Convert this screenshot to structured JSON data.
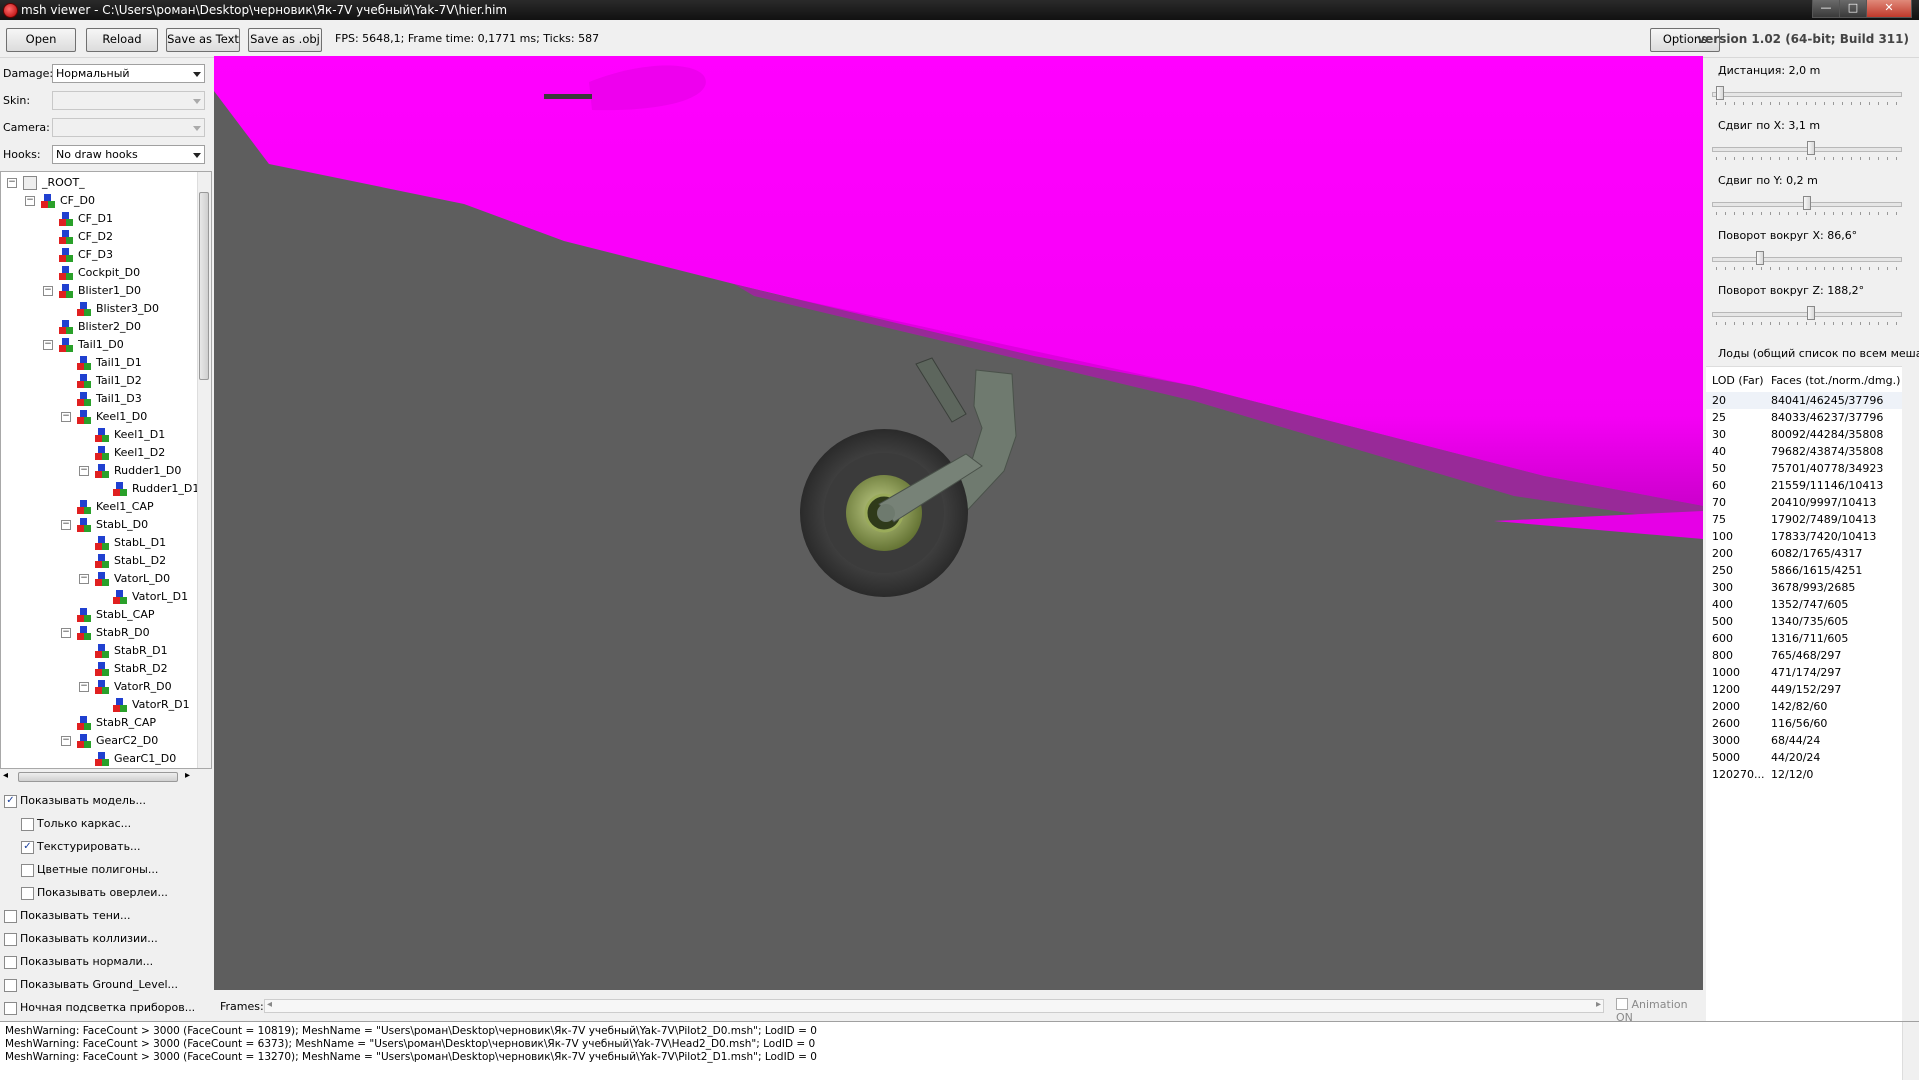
{
  "window": {
    "title": "msh viewer - C:\\Users\\роман\\Desktop\\черновик\\Як-7V учебный\\Yak-7V\\hier.him",
    "minimize": "—",
    "maximize": "□",
    "close": "✕"
  },
  "toolbar": {
    "open": "Open",
    "reload": "Reload",
    "save_text": "Save as Text",
    "save_obj": "Save as .obj",
    "fps": "FPS: 5648,1; Frame time: 0,1771 ms; Ticks: 587",
    "options": "Options",
    "version": "version 1.02 (64-bit; Build 311)"
  },
  "left": {
    "damage_label": "Damage:",
    "damage_value": "Нормальный",
    "skin_label": "Skin:",
    "skin_value": "",
    "camera_label": "Camera:",
    "camera_value": "",
    "hooks_label": "Hooks:",
    "hooks_value": "No draw hooks"
  },
  "tree": [
    {
      "label": "_ROOT_",
      "depth": 0,
      "expander": "minus",
      "icon": "root"
    },
    {
      "label": "CF_D0",
      "depth": 1,
      "expander": "minus",
      "icon": "mesh"
    },
    {
      "label": "CF_D1",
      "depth": 2,
      "expander": "",
      "icon": "mesh"
    },
    {
      "label": "CF_D2",
      "depth": 2,
      "expander": "",
      "icon": "mesh"
    },
    {
      "label": "CF_D3",
      "depth": 2,
      "expander": "",
      "icon": "mesh"
    },
    {
      "label": "Cockpit_D0",
      "depth": 2,
      "expander": "",
      "icon": "mesh"
    },
    {
      "label": "Blister1_D0",
      "depth": 2,
      "expander": "minus",
      "icon": "mesh"
    },
    {
      "label": "Blister3_D0",
      "depth": 3,
      "expander": "",
      "icon": "mesh"
    },
    {
      "label": "Blister2_D0",
      "depth": 2,
      "expander": "",
      "icon": "mesh"
    },
    {
      "label": "Tail1_D0",
      "depth": 2,
      "expander": "minus",
      "icon": "mesh"
    },
    {
      "label": "Tail1_D1",
      "depth": 3,
      "expander": "",
      "icon": "mesh"
    },
    {
      "label": "Tail1_D2",
      "depth": 3,
      "expander": "",
      "icon": "mesh"
    },
    {
      "label": "Tail1_D3",
      "depth": 3,
      "expander": "",
      "icon": "mesh"
    },
    {
      "label": "Keel1_D0",
      "depth": 3,
      "expander": "minus",
      "icon": "mesh"
    },
    {
      "label": "Keel1_D1",
      "depth": 4,
      "expander": "",
      "icon": "mesh"
    },
    {
      "label": "Keel1_D2",
      "depth": 4,
      "expander": "",
      "icon": "mesh"
    },
    {
      "label": "Rudder1_D0",
      "depth": 4,
      "expander": "minus",
      "icon": "mesh"
    },
    {
      "label": "Rudder1_D1",
      "depth": 5,
      "expander": "",
      "icon": "mesh"
    },
    {
      "label": "Keel1_CAP",
      "depth": 3,
      "expander": "",
      "icon": "mesh"
    },
    {
      "label": "StabL_D0",
      "depth": 3,
      "expander": "minus",
      "icon": "mesh"
    },
    {
      "label": "StabL_D1",
      "depth": 4,
      "expander": "",
      "icon": "mesh"
    },
    {
      "label": "StabL_D2",
      "depth": 4,
      "expander": "",
      "icon": "mesh"
    },
    {
      "label": "VatorL_D0",
      "depth": 4,
      "expander": "minus",
      "icon": "mesh"
    },
    {
      "label": "VatorL_D1",
      "depth": 5,
      "expander": "",
      "icon": "mesh"
    },
    {
      "label": "StabL_CAP",
      "depth": 3,
      "expander": "",
      "icon": "mesh"
    },
    {
      "label": "StabR_D0",
      "depth": 3,
      "expander": "minus",
      "icon": "mesh"
    },
    {
      "label": "StabR_D1",
      "depth": 4,
      "expander": "",
      "icon": "mesh"
    },
    {
      "label": "StabR_D2",
      "depth": 4,
      "expander": "",
      "icon": "mesh"
    },
    {
      "label": "VatorR_D0",
      "depth": 4,
      "expander": "minus",
      "icon": "mesh"
    },
    {
      "label": "VatorR_D1",
      "depth": 5,
      "expander": "",
      "icon": "mesh"
    },
    {
      "label": "StabR_CAP",
      "depth": 3,
      "expander": "",
      "icon": "mesh"
    },
    {
      "label": "GearC2_D0",
      "depth": 3,
      "expander": "minus",
      "icon": "mesh"
    },
    {
      "label": "GearC1_D0",
      "depth": 4,
      "expander": "",
      "icon": "mesh"
    }
  ],
  "checkboxes": [
    {
      "label": "Показывать модель...",
      "checked": true,
      "indent": 0
    },
    {
      "label": "Только каркас...",
      "checked": false,
      "indent": 1
    },
    {
      "label": "Текстурировать...",
      "checked": true,
      "indent": 1
    },
    {
      "label": "Цветные полигоны...",
      "checked": false,
      "indent": 1
    },
    {
      "label": "Показывать оверлеи...",
      "checked": false,
      "indent": 1
    },
    {
      "label": "Показывать тени...",
      "checked": false,
      "indent": 0
    },
    {
      "label": "Показывать коллизии...",
      "checked": false,
      "indent": 0
    },
    {
      "label": "Показывать нормали...",
      "checked": false,
      "indent": 0
    },
    {
      "label": "Показывать Ground_Level...",
      "checked": false,
      "indent": 0
    },
    {
      "label": "Ночная подсветка приборов...",
      "checked": false,
      "indent": 0
    }
  ],
  "frames": {
    "label": "Frames:",
    "animation": "Animation ON",
    "left_arrow": "◂",
    "right_arrow": "▸"
  },
  "right": {
    "sliders": [
      {
        "label": "Дистанция:  2,0 m",
        "fraction": 0.02
      },
      {
        "label": "Сдвиг по X:  3,1 m",
        "fraction": 0.52
      },
      {
        "label": "Сдвиг по Y:  0,2 m",
        "fraction": 0.5
      },
      {
        "label": "Поворот вокруг X:  86,6°",
        "fraction": 0.24
      },
      {
        "label": "Поворот вокруг Z:  188,2°",
        "fraction": 0.52
      }
    ],
    "lod_caption": "Лоды (общий список по всем мешам):",
    "lod_header_1": "LOD (Far)",
    "lod_header_2": "Faces (tot./norm./dmg.)",
    "lods": [
      [
        "20",
        "84041/46245/37796"
      ],
      [
        "25",
        "84033/46237/37796"
      ],
      [
        "30",
        "80092/44284/35808"
      ],
      [
        "40",
        "79682/43874/35808"
      ],
      [
        "50",
        "75701/40778/34923"
      ],
      [
        "60",
        "21559/11146/10413"
      ],
      [
        "70",
        "20410/9997/10413"
      ],
      [
        "75",
        "17902/7489/10413"
      ],
      [
        "100",
        "17833/7420/10413"
      ],
      [
        "200",
        "6082/1765/4317"
      ],
      [
        "250",
        "5866/1615/4251"
      ],
      [
        "300",
        "3678/993/2685"
      ],
      [
        "400",
        "1352/747/605"
      ],
      [
        "500",
        "1340/735/605"
      ],
      [
        "600",
        "1316/711/605"
      ],
      [
        "800",
        "765/468/297"
      ],
      [
        "1000",
        "471/174/297"
      ],
      [
        "1200",
        "449/152/297"
      ],
      [
        "2000",
        "142/82/60"
      ],
      [
        "2600",
        "116/56/60"
      ],
      [
        "3000",
        "68/44/24"
      ],
      [
        "5000",
        "44/20/24"
      ],
      [
        "120270...",
        "12/12/0"
      ]
    ]
  },
  "log": [
    "MeshWarning: FaceCount > 3000 (FaceCount = 10819); MeshName = \"Users\\роман\\Desktop\\черновик\\Як-7V учебный\\Yak-7V\\Pilot2_D0.msh\"; LodID = 0",
    "MeshWarning: FaceCount > 3000 (FaceCount = 6373); MeshName = \"Users\\роман\\Desktop\\черновик\\Як-7V учебный\\Yak-7V\\Head2_D0.msh\"; LodID = 0",
    "MeshWarning: FaceCount > 3000 (FaceCount = 13270); MeshName = \"Users\\роман\\Desktop\\черновик\\Як-7V учебный\\Yak-7V\\Pilot2_D1.msh\"; LodID = 0"
  ],
  "colors": {
    "fuselage": "#ff00ff",
    "viewport_bg": "#5e5e5e",
    "tire": "#3a3a3a",
    "hub": "#8fa05a",
    "strut": "#6f7a6f"
  }
}
